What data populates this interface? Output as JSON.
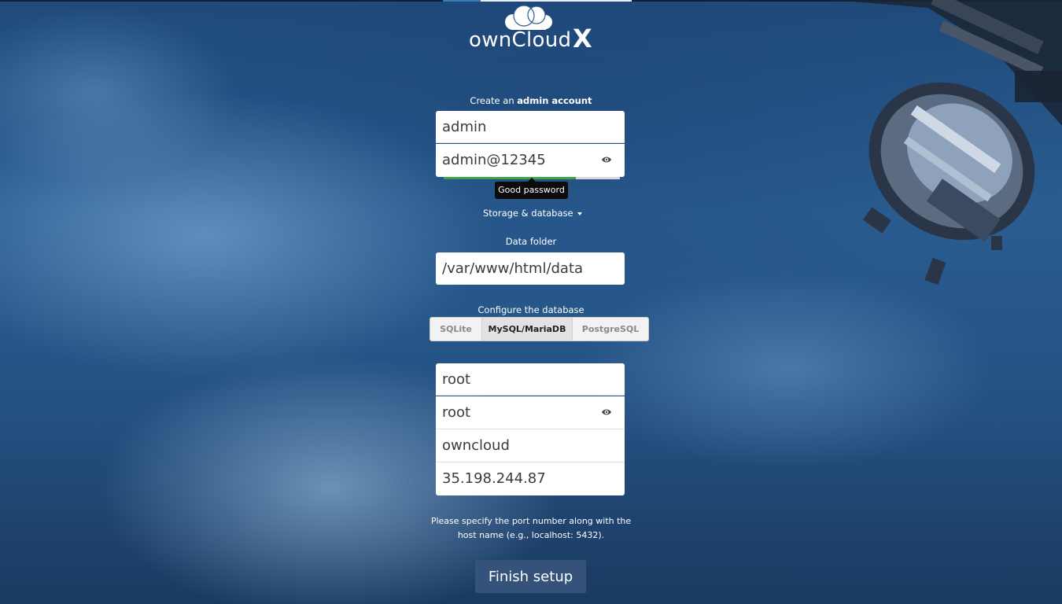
{
  "logo": {
    "text": "ownCloud",
    "mark": "X"
  },
  "admin": {
    "heading_prefix": "Create an",
    "heading_bold": "admin account",
    "username": "admin",
    "password": "admin@12345",
    "strength_tooltip": "Good password",
    "strength_level": 0.75
  },
  "storage": {
    "toggle_label": "Storage & database",
    "data_folder_label": "Data folder",
    "data_folder_value": "/var/www/html/data"
  },
  "database": {
    "label": "Configure the database",
    "tabs": [
      "SQLite",
      "MySQL/MariaDB",
      "PostgreSQL"
    ],
    "selected_tab": "MySQL/MariaDB",
    "user": "root",
    "password": "root",
    "name": "owncloud",
    "host": "35.198.244.87"
  },
  "hint_line1": "Please specify the port number along with the",
  "hint_line2": "host name (e.g., localhost: 5432).",
  "finish_label": "Finish setup",
  "colors": {
    "button": "#35537a",
    "strength_good": "#3ba446"
  }
}
